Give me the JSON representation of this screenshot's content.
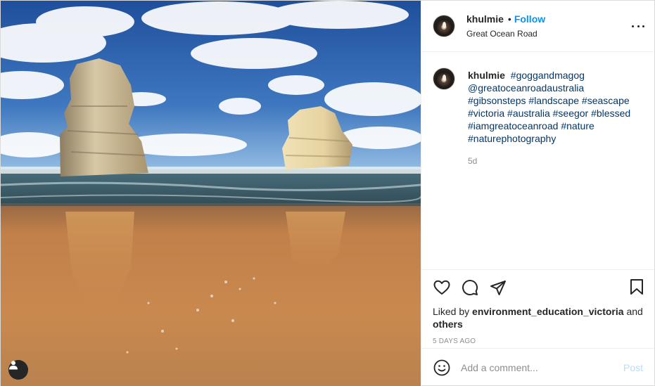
{
  "photo": {
    "alt": "",
    "sky_color": "#2c5fa8",
    "sand_color": "#c8844a",
    "sea_color": "#3d5a66"
  },
  "header": {
    "username": "khulmie",
    "separator": "•",
    "follow_label": "Follow",
    "location": "Great Ocean Road",
    "more_icon": "more-horizontal-icon"
  },
  "caption": {
    "username": "khulmie",
    "tags": [
      "#goggandmagog",
      "@greatoceanroadaustralia",
      "#gibsonsteps",
      "#landscape",
      "#seascape",
      "#victoria",
      "#australia",
      "#seegor",
      "#blessed",
      "#iamgreatoceanroad",
      "#nature",
      "#naturephotography"
    ],
    "time_ago": "5d"
  },
  "actions": {
    "icons": [
      "heart-icon",
      "comment-icon",
      "share-icon",
      "bookmark-icon"
    ],
    "liked_by_prefix": "Liked by",
    "liked_by_user": "environment_education_victoria",
    "liked_by_and": "and",
    "liked_by_others": "others",
    "post_date": "5 DAYS AGO"
  },
  "comment": {
    "placeholder": "Add a comment...",
    "post_label": "Post"
  },
  "colors": {
    "link_blue": "#0095f6",
    "hashtag_blue": "#00376b",
    "muted_gray": "#8e8e8e",
    "post_disabled": "#b2dffc"
  }
}
